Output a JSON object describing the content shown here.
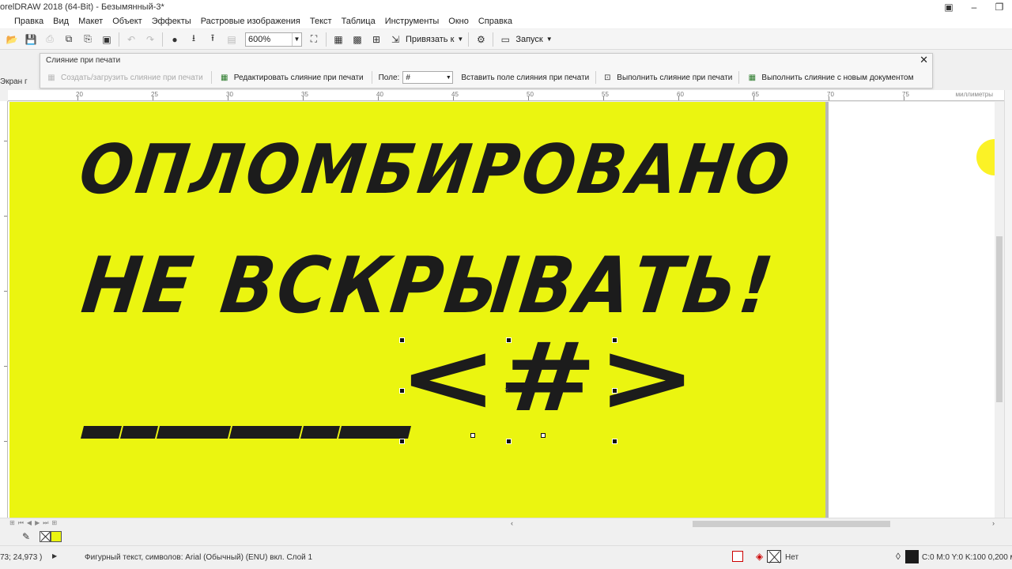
{
  "window": {
    "title": "orelDRAW 2018 (64-Bit) - Безымянный-3*",
    "controls": [
      "▣",
      "–",
      "❐"
    ]
  },
  "menu": [
    "Правка",
    "Вид",
    "Макет",
    "Объект",
    "Эффекты",
    "Растровые изображения",
    "Текст",
    "Таблица",
    "Инструменты",
    "Окно",
    "Справка"
  ],
  "toolbar": {
    "zoom_value": "600%",
    "snap_label": "Привязать к",
    "launch_label": "Запуск"
  },
  "merge_panel": {
    "title": "Слияние при печати",
    "create_label": "Создать/загрузить слияние при печати",
    "edit_label": "Редактировать слияние при печати",
    "field_label": "Поле:",
    "field_value": "#",
    "insert_label": "Вставить поле слияния при печати",
    "perform_label": "Выполнить слияние при печати",
    "perform_new_label": "Выполнить слияние с новым документом"
  },
  "screen_tab": "Экран г",
  "ruler": {
    "labels": [
      "20",
      "25",
      "30",
      "35",
      "40",
      "45",
      "50",
      "55",
      "60",
      "65",
      "70",
      "75"
    ],
    "units": "миллиметры"
  },
  "document": {
    "background_color": "#ebf510",
    "text_color": "#1c1c1c",
    "line1": "ОПЛОМБИРОВАНО",
    "line2": "НЕ ВСКРЫВАТЬ!",
    "merge_field": "<#>"
  },
  "status": {
    "coords": "73; 24,973 )",
    "object_info": "Фигурный текст, символов: Arial (Обычный) (ENU) вкл. Слой 1",
    "outline_none": "Нет",
    "color_values": "C:0 M:0 Y:0 K:100  0,200 м"
  }
}
